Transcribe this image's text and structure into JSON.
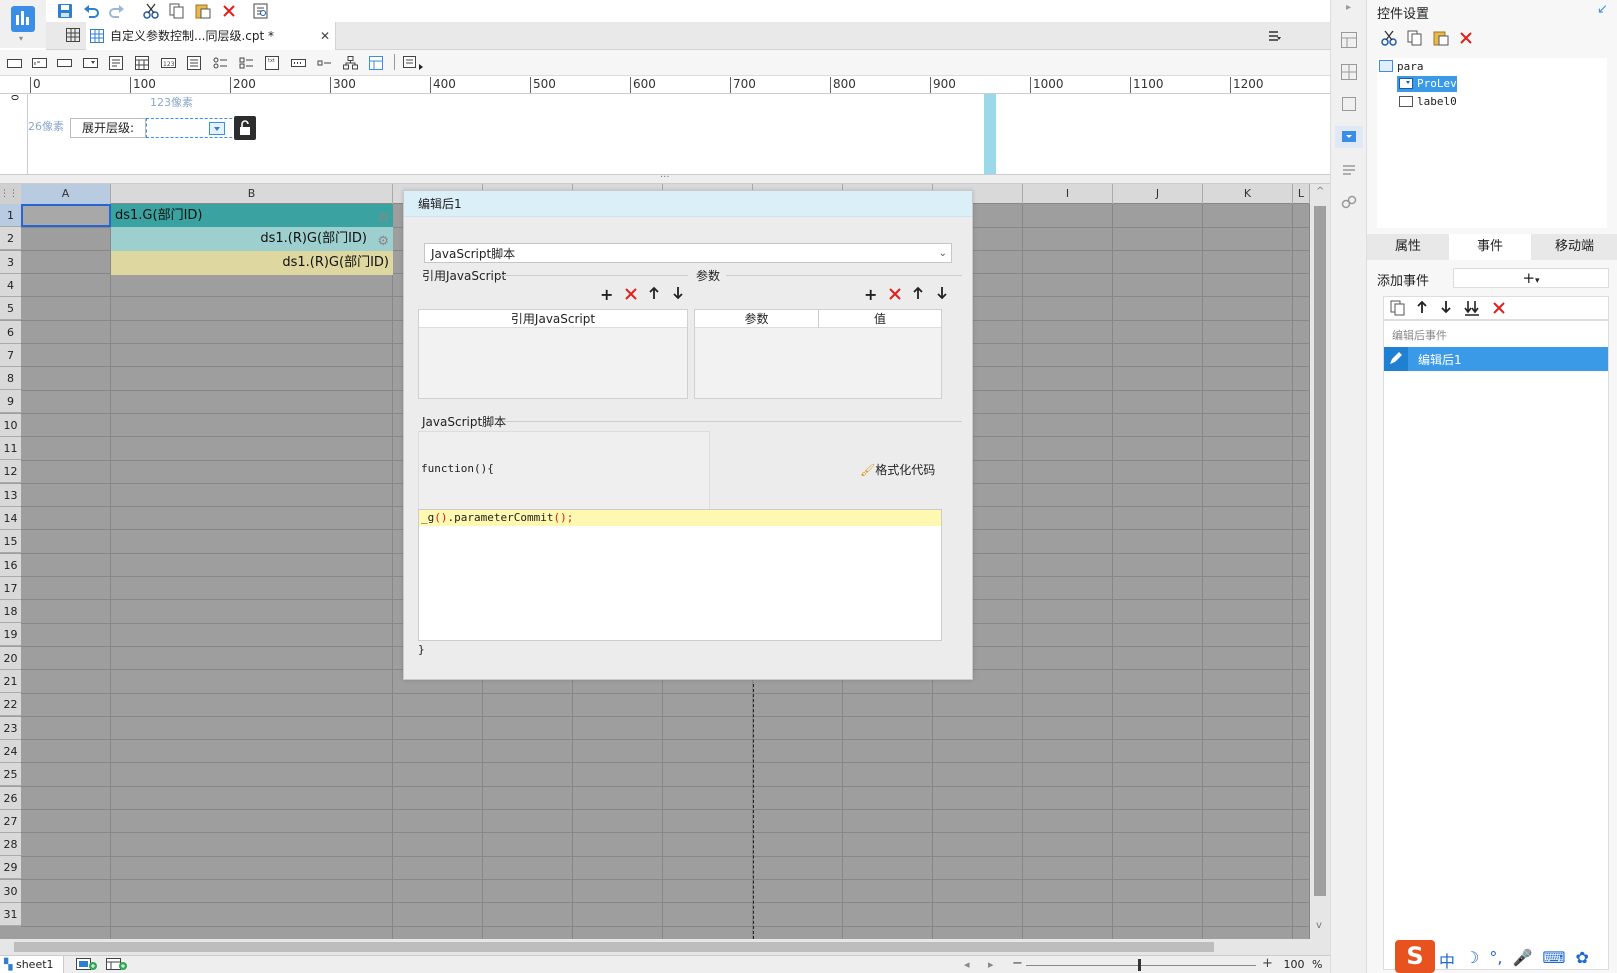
{
  "colors": {
    "accent": "#3a8ee6",
    "teal": "#3aa2a0",
    "lightTeal": "#9dcfcf",
    "yellowCell": "#ded79f",
    "dialogTitle": "#dbeff9",
    "selected": "#3a9ae8"
  },
  "tab": {
    "title": "自定义参数控制...同层级.cpt *",
    "close": "✕"
  },
  "toolbar_icons": [
    "logo-icon",
    "save-icon",
    "undo-icon",
    "redo-icon",
    "cut-icon",
    "copy-icon",
    "paste-icon",
    "delete-icon",
    "preview-icon"
  ],
  "ruler": {
    "ticks": [
      "0",
      "100",
      "200",
      "300",
      "400",
      "500",
      "600",
      "700",
      "800",
      "900",
      "1000",
      "1100",
      "1200"
    ],
    "v_zero": "0"
  },
  "param": {
    "width_label": "123像素",
    "height_label": "26像素",
    "label": "展开层级:"
  },
  "grid": {
    "columns": [
      "A",
      "B",
      "",
      "",
      "",
      "",
      "",
      "",
      "",
      "I",
      "J",
      "K",
      "L"
    ],
    "rows": [
      "1",
      "2",
      "3",
      "4",
      "5",
      "6",
      "7",
      "8",
      "9",
      "10",
      "11",
      "12",
      "13",
      "14",
      "15",
      "16",
      "17",
      "18",
      "19",
      "20",
      "21",
      "22",
      "23",
      "24",
      "25",
      "26",
      "27",
      "28",
      "29",
      "30",
      "31"
    ],
    "cells": {
      "b1": "ds1.G(部门ID)",
      "b2": "ds1.(R)G(部门ID)",
      "b3": "ds1.(R)G(部门ID)"
    }
  },
  "sheet": {
    "name": "sheet1",
    "zoom": "100",
    "zoom_unit": "%"
  },
  "dialog": {
    "title": "编辑后1",
    "script_type": "JavaScript脚本",
    "ref_section": "引用JavaScript",
    "param_section": "参数",
    "ref_col": "引用JavaScript",
    "param_cols": [
      "参数",
      "值"
    ],
    "script_section": "JavaScript脚本",
    "func_open": "function(){",
    "format_btn": "格式化代码",
    "code_prefix": "_g",
    "code_paren": "()",
    "code_method": ".parameterCommit",
    "code_call": "();",
    "func_close": "}"
  },
  "panel": {
    "title": "控件设置",
    "tree": {
      "root": "para",
      "children": [
        "ProLev",
        "label0"
      ]
    },
    "tabs": [
      "属性",
      "事件",
      "移动端"
    ],
    "add_event": "添加事件",
    "event_group": "编辑后事件",
    "event_item": "编辑后1"
  },
  "ime": [
    "中",
    "☽",
    "°,",
    "🎤",
    "⌨",
    "✿"
  ]
}
